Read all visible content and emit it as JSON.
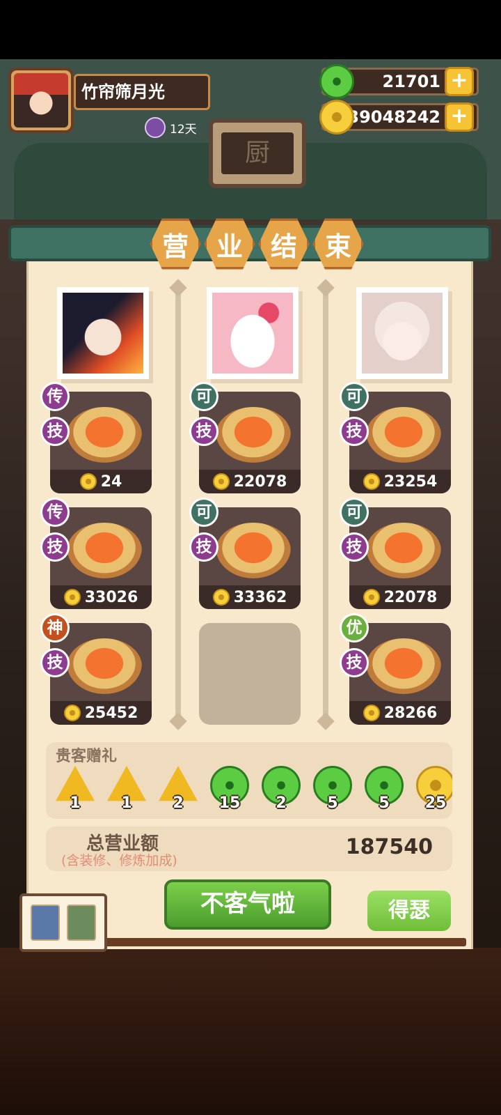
{
  "player": {
    "name": "竹帘筛月光",
    "days": "12天"
  },
  "currencies": {
    "jade": "21701",
    "coins": "39048242",
    "plus": "+"
  },
  "scene": {
    "sign": "厨"
  },
  "banner": {
    "title_chars": [
      "营",
      "业",
      "结",
      "束"
    ]
  },
  "guests": [
    {
      "dishes": [
        {
          "rank": "传",
          "skill": "技",
          "amount": "24"
        },
        {
          "rank": "传",
          "skill": "技",
          "amount": "33026"
        },
        {
          "rank": "神",
          "skill": "技",
          "amount": "25452"
        }
      ]
    },
    {
      "dishes": [
        {
          "rank": "可",
          "skill": "技",
          "amount": "22078"
        },
        {
          "rank": "可",
          "skill": "技",
          "amount": "33362"
        }
      ]
    },
    {
      "dishes": [
        {
          "rank": "可",
          "skill": "技",
          "amount": "23254"
        },
        {
          "rank": "可",
          "skill": "技",
          "amount": "22078"
        },
        {
          "rank": "优",
          "skill": "技",
          "amount": "28266"
        }
      ]
    }
  ],
  "gifts": {
    "title": "贵客赠礼",
    "items": [
      {
        "icon": "gold-triangle-icon",
        "qty": "1"
      },
      {
        "icon": "gold-triangle-icon",
        "qty": "1"
      },
      {
        "icon": "gold-triangle-icon",
        "qty": "2"
      },
      {
        "icon": "jade-icon",
        "qty": "15"
      },
      {
        "icon": "jade-icon",
        "qty": "2"
      },
      {
        "icon": "jade-icon",
        "qty": "5"
      },
      {
        "icon": "jade-icon",
        "qty": "5"
      },
      {
        "icon": "coin-icon",
        "qty": "25"
      }
    ]
  },
  "total": {
    "label": "总营业额",
    "note": "(含装修、修炼加成)",
    "value": "187540"
  },
  "buttons": {
    "thanks": "不客气啦",
    "show_off": "得瑟"
  }
}
